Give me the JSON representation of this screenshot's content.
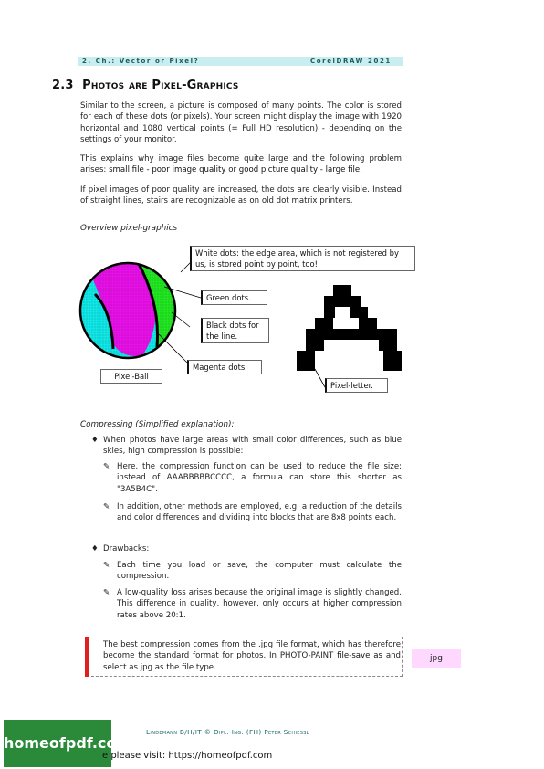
{
  "header": {
    "left": "2. Ch.: Vector or Pixel?",
    "right": "CorelDRAW 2021"
  },
  "section": {
    "number": "2.3",
    "title": "Photos are Pixel-Graphics"
  },
  "paragraphs": {
    "p1_a": "Similar to the screen, a picture is composed of many points. The color is stored for each of these ",
    "p1_b": "dots (or pixels)",
    "p1_c": ". Your screen might display the image with 1920 horizontal and 1080 vertical points (= Full HD resolution) - depending on the settings of your monitor.",
    "p2_a": "This explains why image files become quite large and the following problem arises: ",
    "p2_b": "small file - poor image quality",
    "p2_c": " or ",
    "p2_d": "good picture quality - large file",
    "p2_e": ".",
    "p3": "If pixel images of poor quality are increased, the dots are clearly visible. Instead of straight lines, stairs are recognizable as on old dot matrix printers."
  },
  "figure": {
    "caption": "Overview pixel-graphics",
    "callouts": {
      "white_dots": "White dots: the edge area, which is not registered by us, is stored point by point, too!",
      "green_dots": "Green dots.",
      "black_dots": "Black dots for the line.",
      "magenta_dots": "Magenta dots.",
      "pixel_ball": "Pixel-Ball",
      "pixel_letter": "Pixel-letter."
    },
    "colors": {
      "green": "#22ee22",
      "magenta": "#ee11ee",
      "cyan": "#11eeee",
      "black": "#000000"
    }
  },
  "compressing": {
    "caption": "Compressing (Simplified explanation):",
    "bullets": [
      {
        "text": "When photos have large areas with small color differences, such as blue skies, high compression is possible:",
        "subs": [
          "Here, the compression function can be used to reduce the file size: instead of AAABBBBBCCCC, a formula can store this shorter as \"3A5B4C\".",
          "In addition, other methods are employed, e.g. a reduction of the details and color differences and dividing into blocks that are 8x8 points each."
        ]
      },
      {
        "text": "Drawbacks:",
        "subs": [
          "Each time you load or save, the computer must calculate the compression.",
          "A low-quality loss arises because the original image is slightly changed. This difference in quality, however, only occurs at higher compression rates above 20:1."
        ]
      }
    ],
    "bullet_glyph": "♦",
    "sub_glyph": "✎"
  },
  "tip": {
    "a": "The best compression comes from the .jpg file format, which has therefore become the standard format for photos. In PHOTO-PAINT ",
    "b": "file-save as",
    "c": " and select as jpg as the file type.",
    "side_tag": "jpg"
  },
  "footer": {
    "text": "Lindemann B/H/IT © Dipl.-Ing. (FH) Peter Schiessl"
  },
  "watermark": {
    "logo": "homeofpdf.com",
    "visit": "e please visit: https://homeofpdf.com"
  }
}
